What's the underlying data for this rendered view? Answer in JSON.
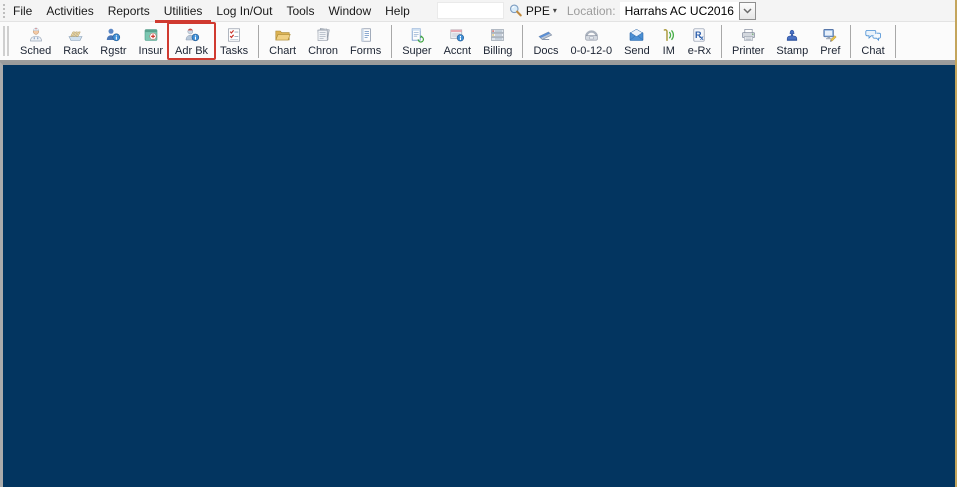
{
  "menu_bar": {
    "items": [
      {
        "label": "File"
      },
      {
        "label": "Activities"
      },
      {
        "label": "Reports"
      },
      {
        "label": "Utilities"
      },
      {
        "label": "Log In/Out"
      },
      {
        "label": "Tools"
      },
      {
        "label": "Window"
      },
      {
        "label": "Help"
      }
    ],
    "search": {
      "value": "",
      "placeholder": ""
    },
    "scope": {
      "label": "PPE",
      "dropdown_glyph": "▾"
    },
    "location": {
      "label": "Location:",
      "value": "Harrahs AC UC2016"
    }
  },
  "toolbar": {
    "groups": [
      {
        "buttons": [
          {
            "label": "Sched",
            "icon": "schedule-icon"
          },
          {
            "label": "Rack",
            "icon": "rack-icon"
          },
          {
            "label": "Rgstr",
            "icon": "register-icon"
          },
          {
            "label": "Insur",
            "icon": "insurance-icon"
          },
          {
            "label": "Adr Bk",
            "icon": "address-book-icon",
            "highlighted": true
          },
          {
            "label": "Tasks",
            "icon": "tasks-icon"
          }
        ]
      },
      {
        "buttons": [
          {
            "label": "Chart",
            "icon": "chart-folder-icon"
          },
          {
            "label": "Chron",
            "icon": "chron-icon"
          },
          {
            "label": "Forms",
            "icon": "forms-icon"
          }
        ]
      },
      {
        "buttons": [
          {
            "label": "Super",
            "icon": "superbill-icon"
          },
          {
            "label": "Accnt",
            "icon": "account-icon"
          },
          {
            "label": "Billing",
            "icon": "billing-icon"
          }
        ]
      },
      {
        "buttons": [
          {
            "label": "Docs",
            "icon": "docs-scanner-icon"
          },
          {
            "label": "0-0-12-0",
            "icon": "phone-icon"
          },
          {
            "label": "Send",
            "icon": "send-envelope-icon"
          },
          {
            "label": "IM",
            "icon": "im-icon"
          },
          {
            "label": "e-Rx",
            "icon": "erx-icon"
          }
        ]
      },
      {
        "buttons": [
          {
            "label": "Printer",
            "icon": "printer-icon"
          },
          {
            "label": "Stamp",
            "icon": "stamp-icon"
          },
          {
            "label": "Pref",
            "icon": "preferences-icon"
          }
        ]
      },
      {
        "buttons": [
          {
            "label": "Chat",
            "icon": "chat-icon"
          }
        ]
      }
    ]
  },
  "annotations": {
    "underlined_menu_item": "Utilities",
    "boxed_toolbar_button": "Adr Bk",
    "highlight_color": "#d03a30"
  },
  "colors": {
    "workspace": "#033560",
    "toolbar_background": "#fbfbfb",
    "menu_background": "#f4f4f4",
    "window_right_border": "#c4a55c"
  }
}
